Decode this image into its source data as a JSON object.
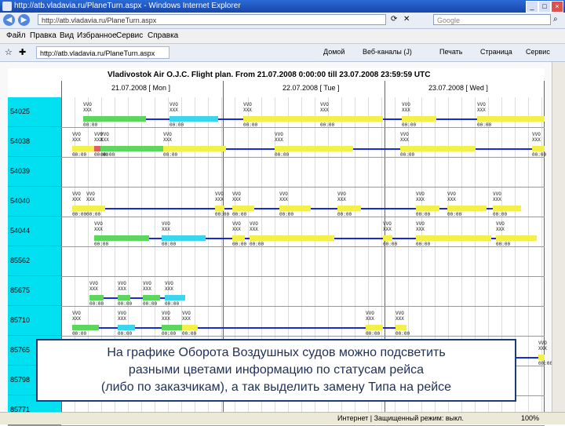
{
  "window": {
    "title": "http://atb.vladavia.ru/PlaneTurn.aspx - Windows Internet Explorer",
    "min": "_",
    "max": "□",
    "close": "×"
  },
  "address": {
    "url": "http://atb.vladavia.ru/PlaneTurn.aspx",
    "search_placeholder": "Google"
  },
  "menu": [
    "Файл",
    "Правка",
    "Вид",
    "Избранное",
    "Сервис",
    "Справка"
  ],
  "tab": {
    "label": "http://atb.vladavia.ru/PlaneTurn.aspx"
  },
  "commands": [
    "Домой",
    "Веб-каналы (J)",
    "Печать",
    "Страница",
    "Сервис"
  ],
  "plan": {
    "title": "Vladivostok Air O.J.C. Flight plan. From 21.07.2008 0:00:00 till 23.07.2008 23:59:59 UTC",
    "days": [
      "21.07.2008 [ Mon ]",
      "22.07.2008 [ Tue ]",
      "23.07.2008 [ Wed ]"
    ],
    "registrations": [
      "54025",
      "54038",
      "54039",
      "54040",
      "54044",
      "85562",
      "85675",
      "85710",
      "85765",
      "85798",
      "85771"
    ]
  },
  "caption": {
    "line1": "На графике Оборота Воздушных судов можно подсветить",
    "line2": "разными цветами информацию по статусам рейса",
    "line3": "(либо по заказчикам), а так выделить замену Типа на рейсе"
  },
  "statusbar": {
    "zone": "Интернет | Защищенный режим: выкл.",
    "zoom": "100%"
  },
  "colors": {
    "green": "#5cd65c",
    "cyan": "#39d6ee",
    "yellow": "#f4f04a",
    "red": "#e06060",
    "blue": "#1a2ad8",
    "registration_fill": "#00e0f0"
  }
}
